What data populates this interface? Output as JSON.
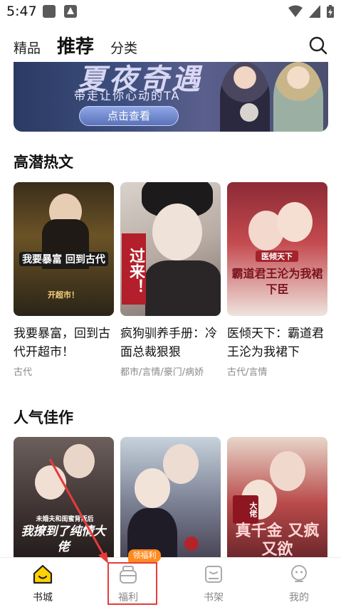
{
  "status_bar": {
    "time": "5:47"
  },
  "top_nav": {
    "tabs": [
      {
        "label": "精品"
      },
      {
        "label": "推荐"
      },
      {
        "label": "分类"
      }
    ],
    "active_tab": "推荐"
  },
  "banner": {
    "title": "夏夜奇遇",
    "subtitle": "带走让你心动的TA",
    "button": "点击查看"
  },
  "sections": [
    {
      "title": "高潜热文",
      "books": [
        {
          "title": "我要暴富，回到古代开超市！",
          "tag": "古代",
          "cover_text": "我要暴富 回到古代",
          "cover_sub": "开超市！"
        },
        {
          "title": "疯狗驯养手册：冷面总裁狠狠",
          "tag": "都市/言情/豪门/病娇",
          "cover_text": "过来！"
        },
        {
          "title": "医倾天下：霸道君王沦为我裙下",
          "tag": "古代/言情",
          "cover_text": "霸道君王沦为我裙下臣",
          "cover_sub": "医倾天下"
        }
      ]
    },
    {
      "title": "人气佳作",
      "books": [
        {
          "cover_text": "我撩到了纯情大佬",
          "cover_sub": "未婚夫和闺蜜背叛后"
        },
        {
          "cover_text": ""
        },
        {
          "cover_text": "真千金 又疯又欲",
          "cover_sub": "大佬"
        }
      ]
    }
  ],
  "bottom_nav": {
    "items": [
      {
        "label": "书城",
        "icon": "home-icon"
      },
      {
        "label": "福利",
        "icon": "gift-pot-icon"
      },
      {
        "label": "书架",
        "icon": "bookshelf-icon"
      },
      {
        "label": "我的",
        "icon": "profile-icon"
      }
    ],
    "welfare_badge": "领福利",
    "accent": "#ffd100"
  }
}
